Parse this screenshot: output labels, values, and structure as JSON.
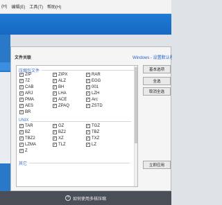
{
  "menu": [
    "(H)",
    "编辑(E)",
    "工具(T)",
    "帮助(H)"
  ],
  "dialog": {
    "title": "文件关联",
    "hint": "Windows - 设置默认程序"
  },
  "groups": [
    {
      "label": "压缩包文件",
      "items": [
        "ZIP",
        "ZIPX",
        "RAR",
        "7Z",
        "ALZ",
        "EGG",
        "CAB",
        "BH",
        "001",
        "ARJ",
        "LHA",
        "LZH",
        "PMA",
        "ACE",
        "Arc",
        "AES",
        "ZPAQ",
        "ZSTD",
        "BR"
      ]
    },
    {
      "label": "UNIX",
      "items": [
        "TAR",
        "GZ",
        "TGZ",
        "BZ",
        "BZ2",
        "TBZ",
        "TBZ2",
        "XZ",
        "TXZ",
        "LZMA",
        "TLZ",
        "LZ",
        "Z"
      ]
    },
    {
      "label": "其它",
      "items": []
    }
  ],
  "buttons": {
    "basic": "基本选项",
    "select_all": "全选",
    "deselect_all": "取消全选",
    "apply": "立即应用"
  },
  "taskbar": {
    "icon": "?",
    "text": "如何使用多核压缩"
  },
  "colors": {
    "accent": "#1f7bd6",
    "group_label": "#3a6fc9",
    "hint": "#1f5fd0"
  }
}
